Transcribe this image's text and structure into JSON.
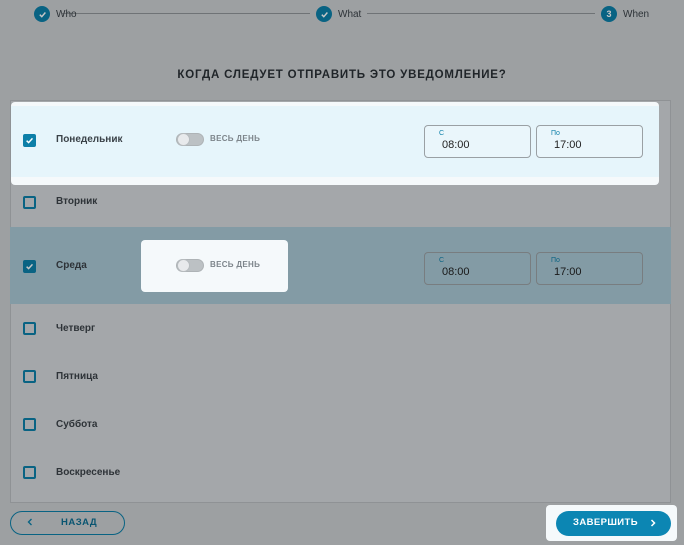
{
  "stepper": {
    "steps": [
      {
        "label": "Who",
        "mark": "check-icon"
      },
      {
        "label": "What",
        "mark": "check-icon"
      },
      {
        "label": "When",
        "number": "3"
      }
    ]
  },
  "title": "КОГДА СЛЕДУЕТ ОТПРАВИТЬ ЭТО УВЕДОМЛЕНИЕ?",
  "days": [
    {
      "name": "Понедельник",
      "checked": true,
      "all_day_label": "ВЕСЬ ДЕНЬ",
      "from_label": "С",
      "from": "08:00",
      "to_label": "По",
      "to": "17:00"
    },
    {
      "name": "Вторник",
      "checked": false
    },
    {
      "name": "Среда",
      "checked": true,
      "all_day_label": "ВЕСЬ ДЕНЬ",
      "from_label": "С",
      "from": "08:00",
      "to_label": "По",
      "to": "17:00"
    },
    {
      "name": "Четверг",
      "checked": false
    },
    {
      "name": "Пятница",
      "checked": false
    },
    {
      "name": "Суббота",
      "checked": false
    },
    {
      "name": "Воскресенье",
      "checked": false
    }
  ],
  "buttons": {
    "back": "НАЗАД",
    "finish": "ЗАВЕРШИТЬ"
  },
  "colors": {
    "accent": "#0c7fa8",
    "selected_row": "#a8c7d4"
  }
}
